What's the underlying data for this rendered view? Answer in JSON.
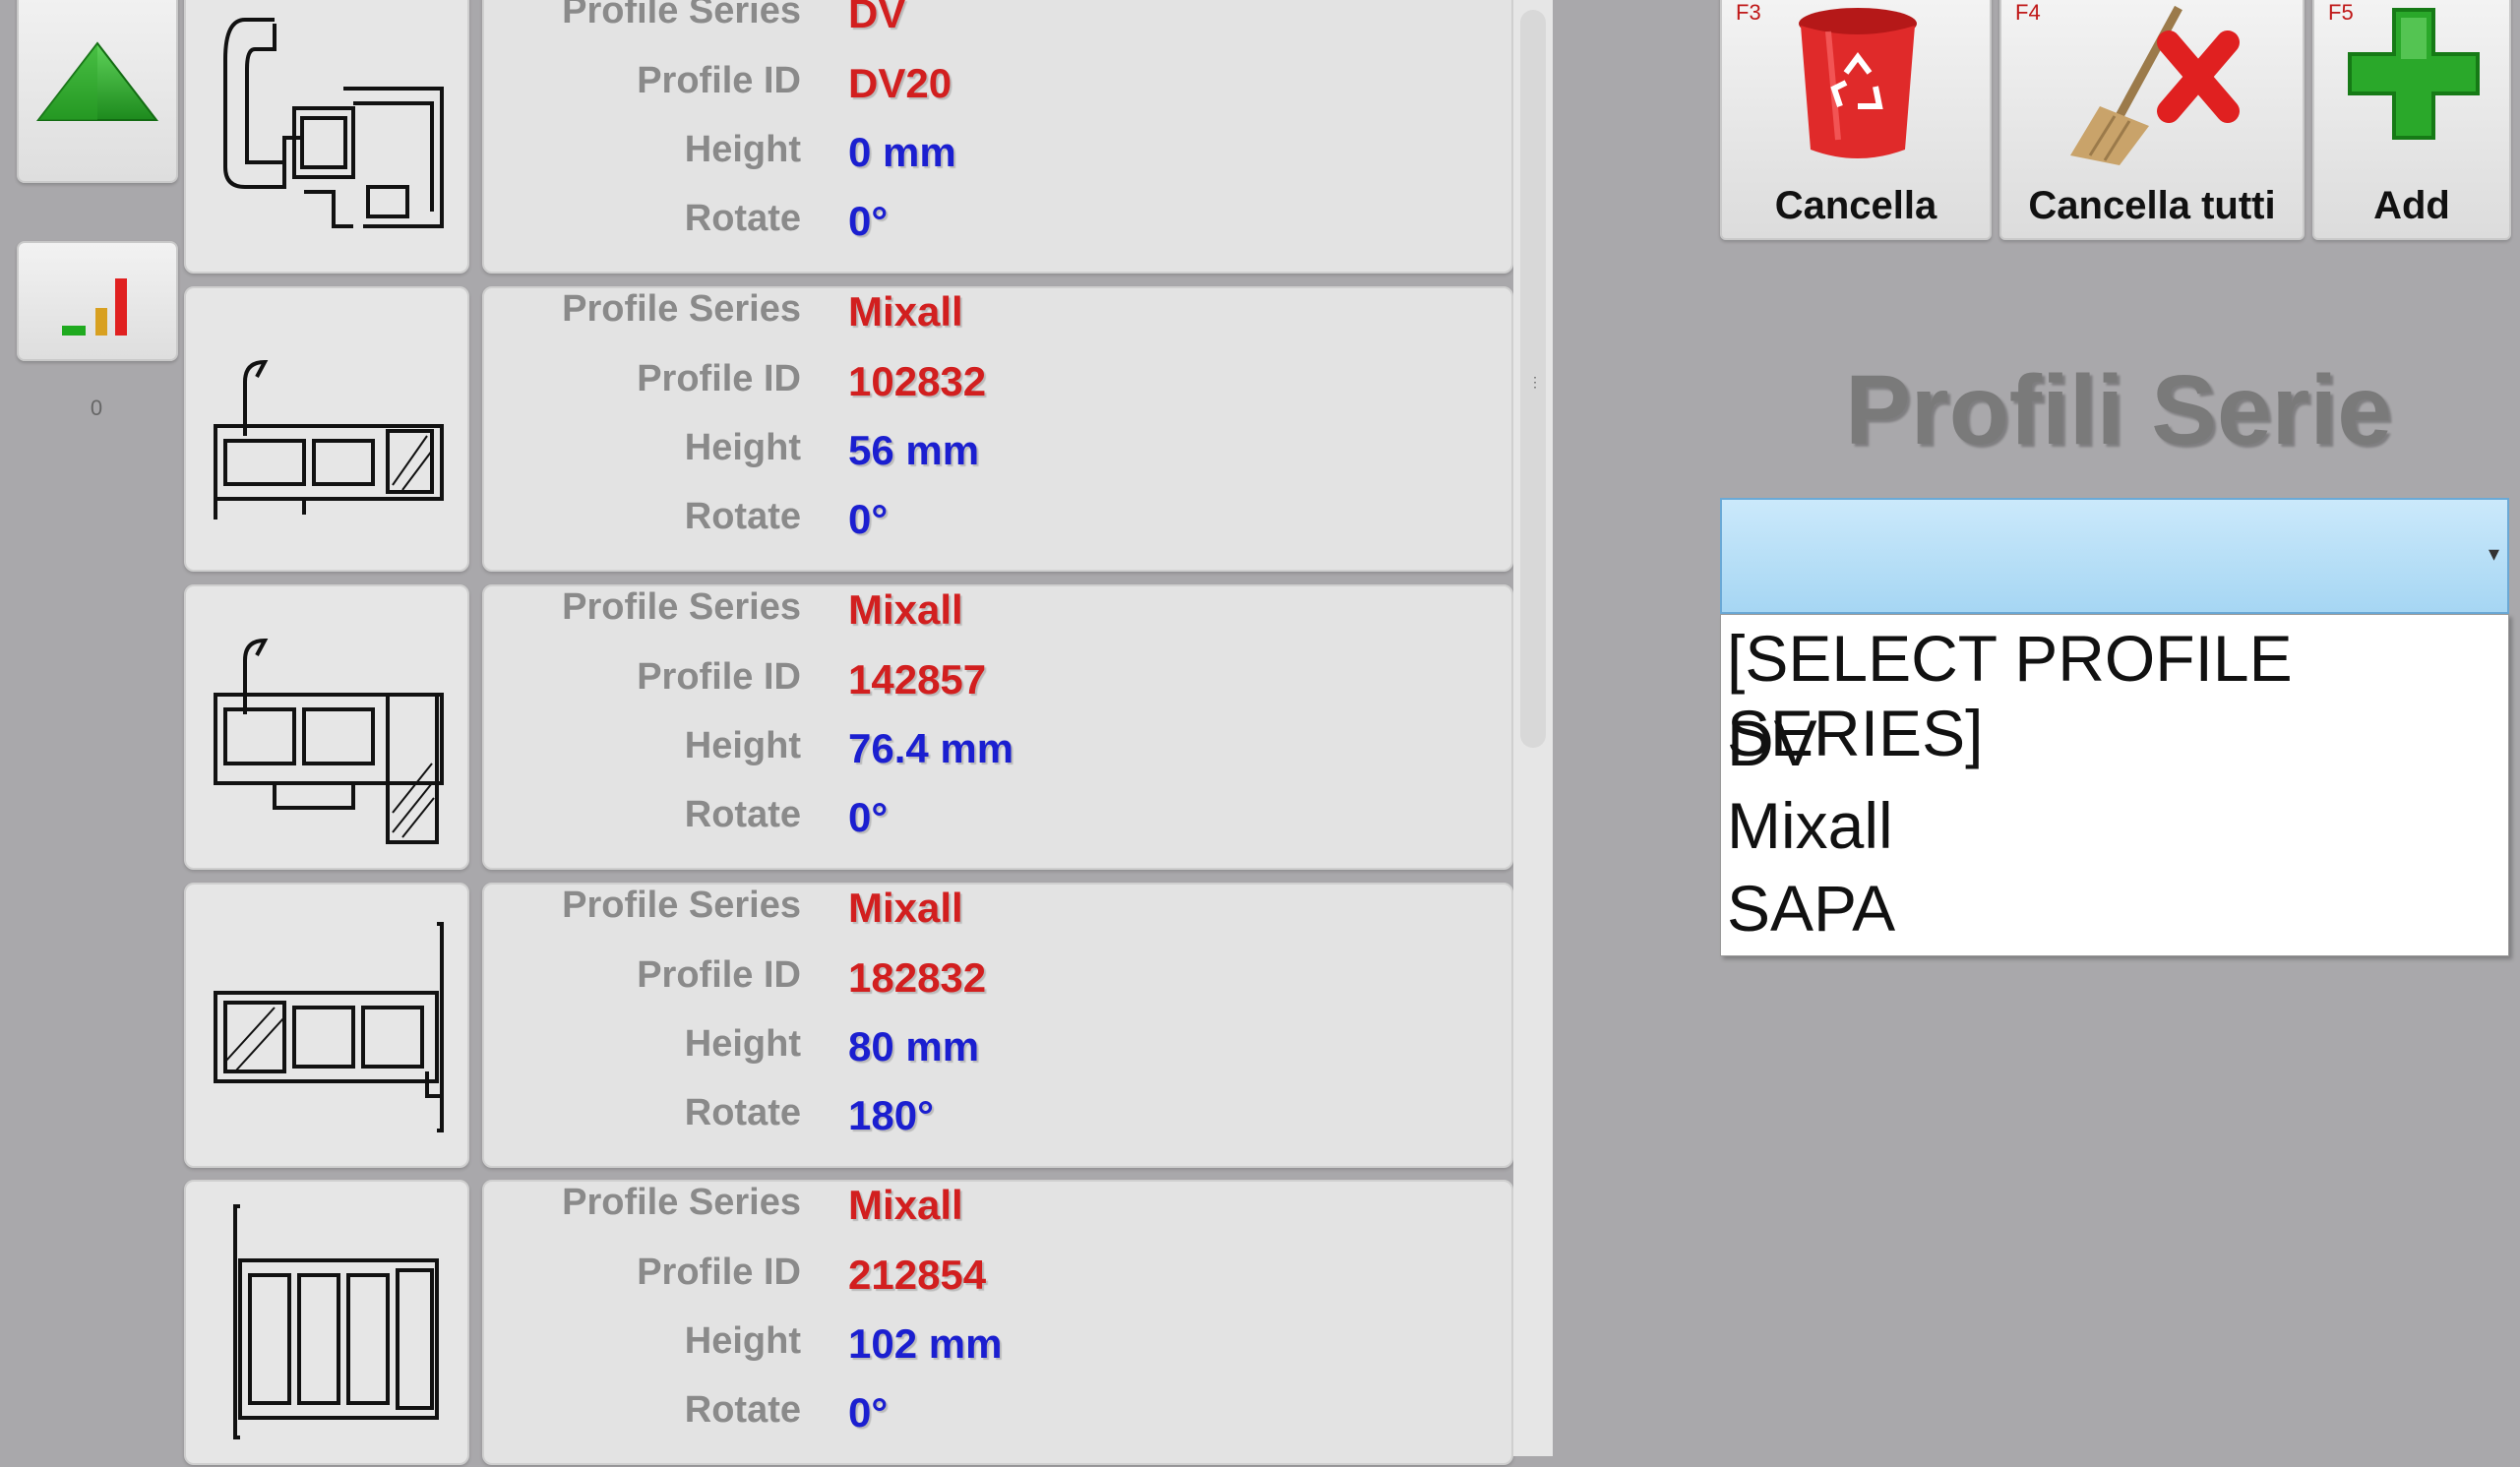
{
  "labels": {
    "series": "Profile Series",
    "id": "Profile ID",
    "height": "Height",
    "rotate": "Rotate"
  },
  "sidebar": {
    "count": "0"
  },
  "profiles": [
    {
      "series": "DV",
      "id": "DV20",
      "height": "0 mm",
      "rotate": "0°"
    },
    {
      "series": "Mixall",
      "id": "102832",
      "height": "56 mm",
      "rotate": "0°"
    },
    {
      "series": "Mixall",
      "id": "142857",
      "height": "76.4 mm",
      "rotate": "0°"
    },
    {
      "series": "Mixall",
      "id": "182832",
      "height": "80 mm",
      "rotate": "180°"
    },
    {
      "series": "Mixall",
      "id": "212854",
      "height": "102 mm",
      "rotate": "0°"
    }
  ],
  "toolbar": {
    "delete": {
      "key": "F3",
      "label": "Cancella"
    },
    "delete_all": {
      "key": "F4",
      "label": "Cancella tutti"
    },
    "add": {
      "key": "F5",
      "label": "Add"
    }
  },
  "section_title": "Profili Serie",
  "series_select": {
    "value": "",
    "options": [
      "[SELECT PROFILE SERIES]",
      "DV",
      "Mixall",
      "SAPA"
    ]
  },
  "colors": {
    "value_red": "#d21f1f",
    "value_blue": "#1b1fd0",
    "select_highlight": "#a6d6f3"
  }
}
